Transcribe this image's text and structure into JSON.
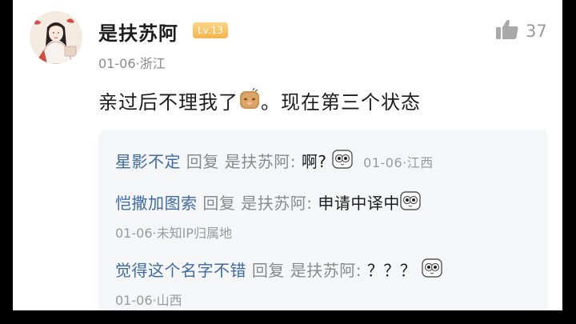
{
  "post": {
    "username": "是扶苏阿",
    "level": "Lv.13",
    "meta": "01-06·浙江",
    "likes": "37",
    "content_main": "亲过后不理我了",
    "content_tail": "。现在第三个状态"
  },
  "replies": [
    {
      "author": "星影不定",
      "verb": "回复",
      "target": "是扶苏阿:",
      "text": "啊?",
      "meta": "01-06·江西"
    },
    {
      "author": "恺撒加图索",
      "verb": "回复",
      "target": "是扶苏阿:",
      "text": "申请中译中",
      "meta": "01-06·未知IP归属地"
    },
    {
      "author": "觉得这个名字不错",
      "verb": "回复",
      "target": "是扶苏阿:",
      "text": "？？？",
      "meta": "01-06·山西"
    }
  ],
  "icons": {
    "like": "thumbs-up-icon",
    "avatar": "user-avatar",
    "emoji_face": "blushing-face-emoji",
    "emoji_eyes": "staring-eyes-emoji"
  },
  "colors": {
    "author": "#3f6aa7",
    "level_badge": "#f5b34a",
    "reply_bg": "#f5f6f8"
  }
}
